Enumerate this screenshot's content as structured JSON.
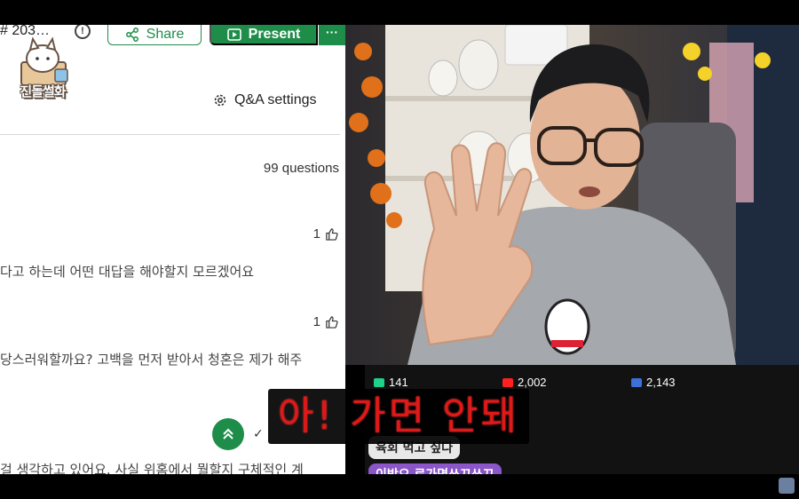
{
  "slido": {
    "event_code": "# 203…",
    "share_label": "Share",
    "present_label": "Present",
    "more_label": "···",
    "qa_settings_label": "Q&A settings",
    "question_count": "99 questions",
    "questions": [
      {
        "likes": "1",
        "text": "다고 하는데 어떤 대답을 해야할지 모르겠어요"
      },
      {
        "likes": "1",
        "text": "당스러워할까요? 고백을 먼저 받아서 청혼은 제가 해주"
      },
      {
        "likes": "",
        "text": "걸 생각하고 있어요. 사실 위홈에서 뭘할지 구체적인 계"
      }
    ],
    "check_label": "✓"
  },
  "channel": {
    "logo_text": "진돌썰화"
  },
  "stream_stats": {
    "chzzk_viewers": "141",
    "youtube_viewers": "2,002",
    "other_viewers": "2,143",
    "chat_message_1": "육회 먹고 싶다",
    "chat_message_2": "이방오 로가면쓰끄쓰끄"
  },
  "subtitle": {
    "text": "아! 가면 안돼"
  },
  "colors": {
    "slido_green": "#1f8d4a",
    "subtitle_red": "#e01818",
    "chzzk_green": "#1ed28a",
    "youtube_red": "#ff2020",
    "other_blue": "#3f6fd8"
  }
}
